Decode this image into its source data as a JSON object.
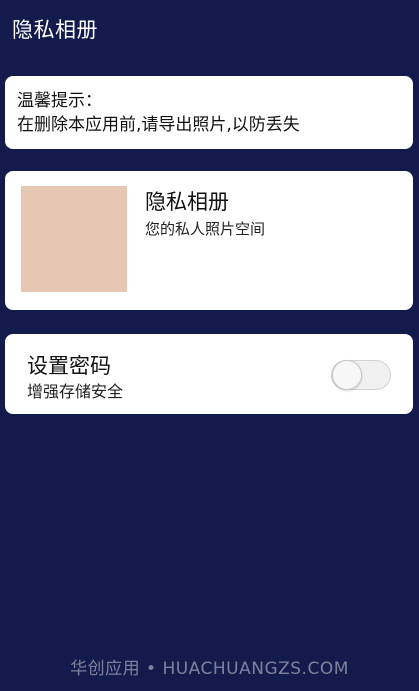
{
  "header": {
    "title": "隐私相册"
  },
  "tip": {
    "title": "温馨提示：",
    "message": "在删除本应用前,请导出照片,以防丢失"
  },
  "album": {
    "title": "隐私相册",
    "subtitle": "您的私人照片空间",
    "thumbnail_color": "#e6c7b3"
  },
  "password": {
    "title": "设置密码",
    "subtitle": "增强存储安全",
    "enabled": false
  },
  "watermark": {
    "text": "华创应用 • HUACHUANGZS.COM"
  },
  "colors": {
    "background": "#131a4c",
    "card": "#ffffff"
  }
}
